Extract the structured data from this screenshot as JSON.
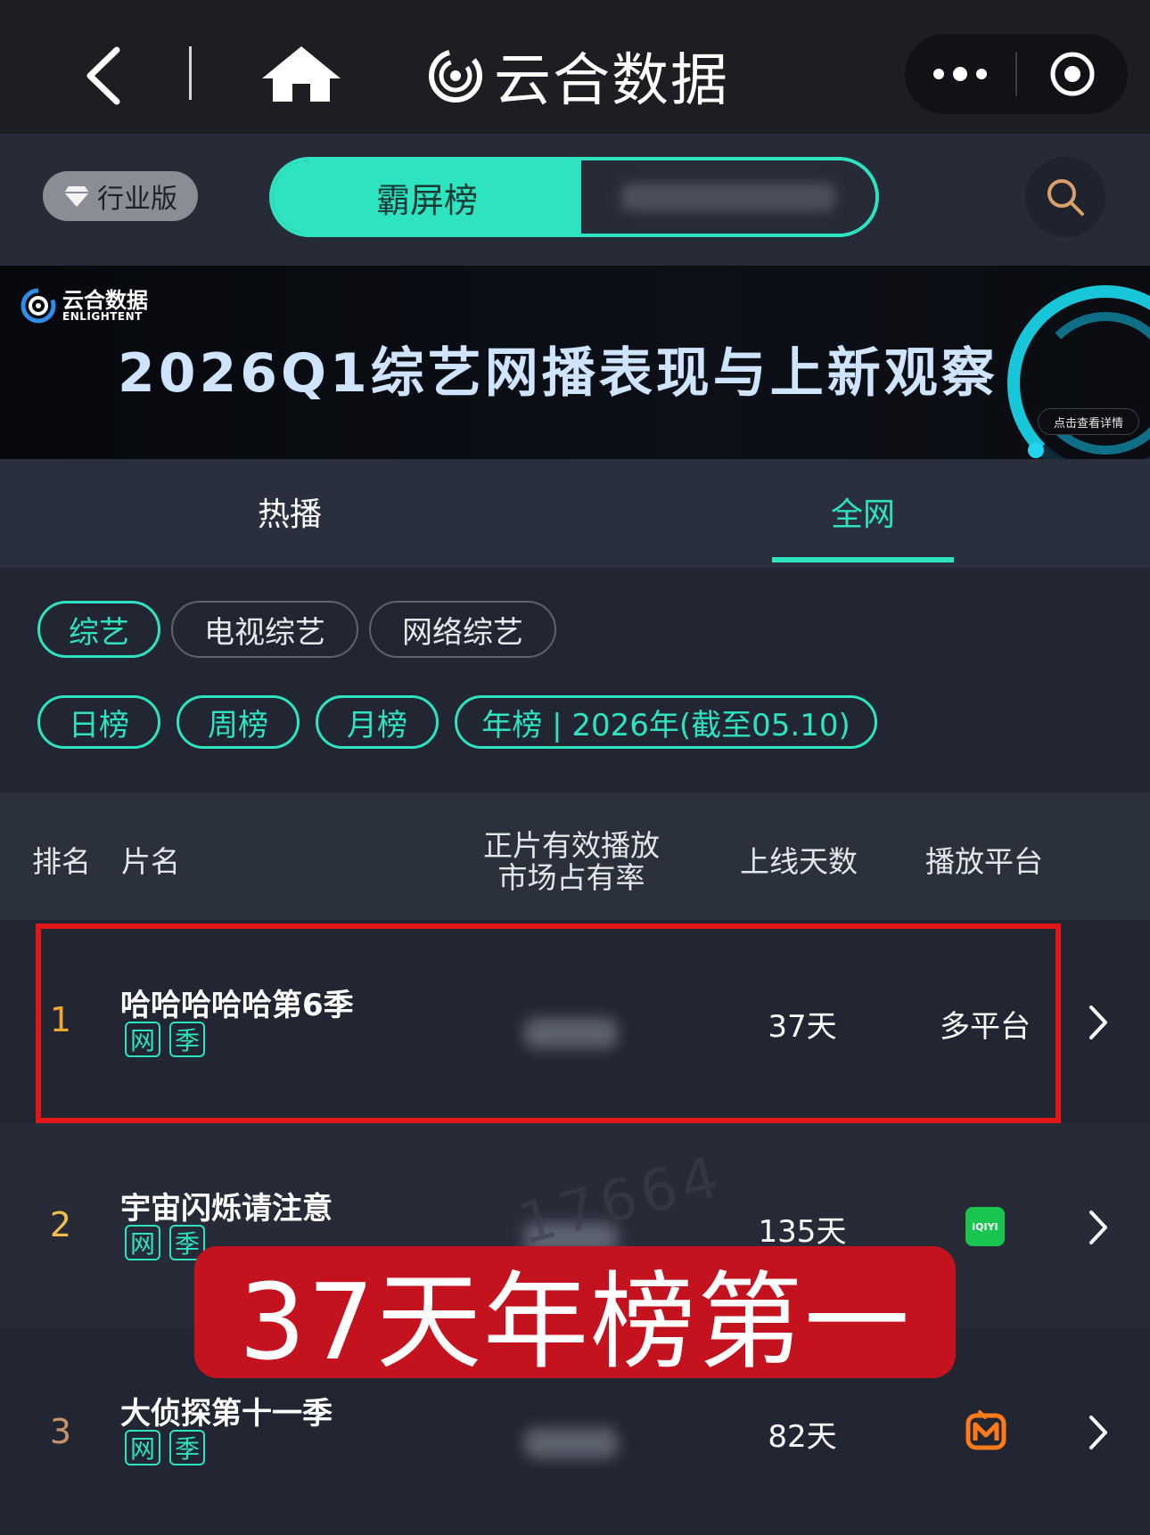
{
  "navbar": {
    "title": "云合数据"
  },
  "subbar": {
    "industry_badge": "行业版",
    "segments": {
      "active": "霸屏榜"
    }
  },
  "banner": {
    "logo_cn": "云合数据",
    "logo_en": "ENLIGHTENT",
    "headline": "2026Q1综艺网播表现与上新观察",
    "detail_button": "点击查看详情"
  },
  "tabs": {
    "hot": "热播",
    "all": "全网"
  },
  "filters": {
    "genre": [
      "综艺",
      "电视综艺",
      "网络综艺"
    ],
    "period": [
      "日榜",
      "周榜",
      "月榜",
      "年榜 | 2026年(截至05.10)"
    ]
  },
  "table": {
    "headers": {
      "rank": "排名",
      "name": "片名",
      "share_line1": "正片有效播放",
      "share_line2": "市场占有率",
      "days": "上线天数",
      "platform": "播放平台"
    },
    "rows": [
      {
        "rank": "1",
        "title": "哈哈哈哈哈第6季",
        "tags": [
          "网",
          "季"
        ],
        "days": "37天",
        "platform": "多平台",
        "platform_icon": ""
      },
      {
        "rank": "2",
        "title": "宇宙闪烁请注意",
        "tags": [
          "网",
          "季"
        ],
        "days": "135天",
        "platform": "",
        "platform_icon": "iqiyi-icon"
      },
      {
        "rank": "3",
        "title": "大侦探第十一季",
        "tags": [
          "网",
          "季"
        ],
        "days": "82天",
        "platform": "",
        "platform_icon": "mango-tv-icon"
      }
    ]
  },
  "iqiyi_label": "iQIYI",
  "watermark": "17664",
  "overlay_caption": "37天年榜第一",
  "colors": {
    "accent": "#2de3c0",
    "highlight_border": "#e01717",
    "caption_bg": "#c4131f",
    "rank1": "#f0a830",
    "rank2": "#f0c04a",
    "rank3": "#c9946a"
  }
}
